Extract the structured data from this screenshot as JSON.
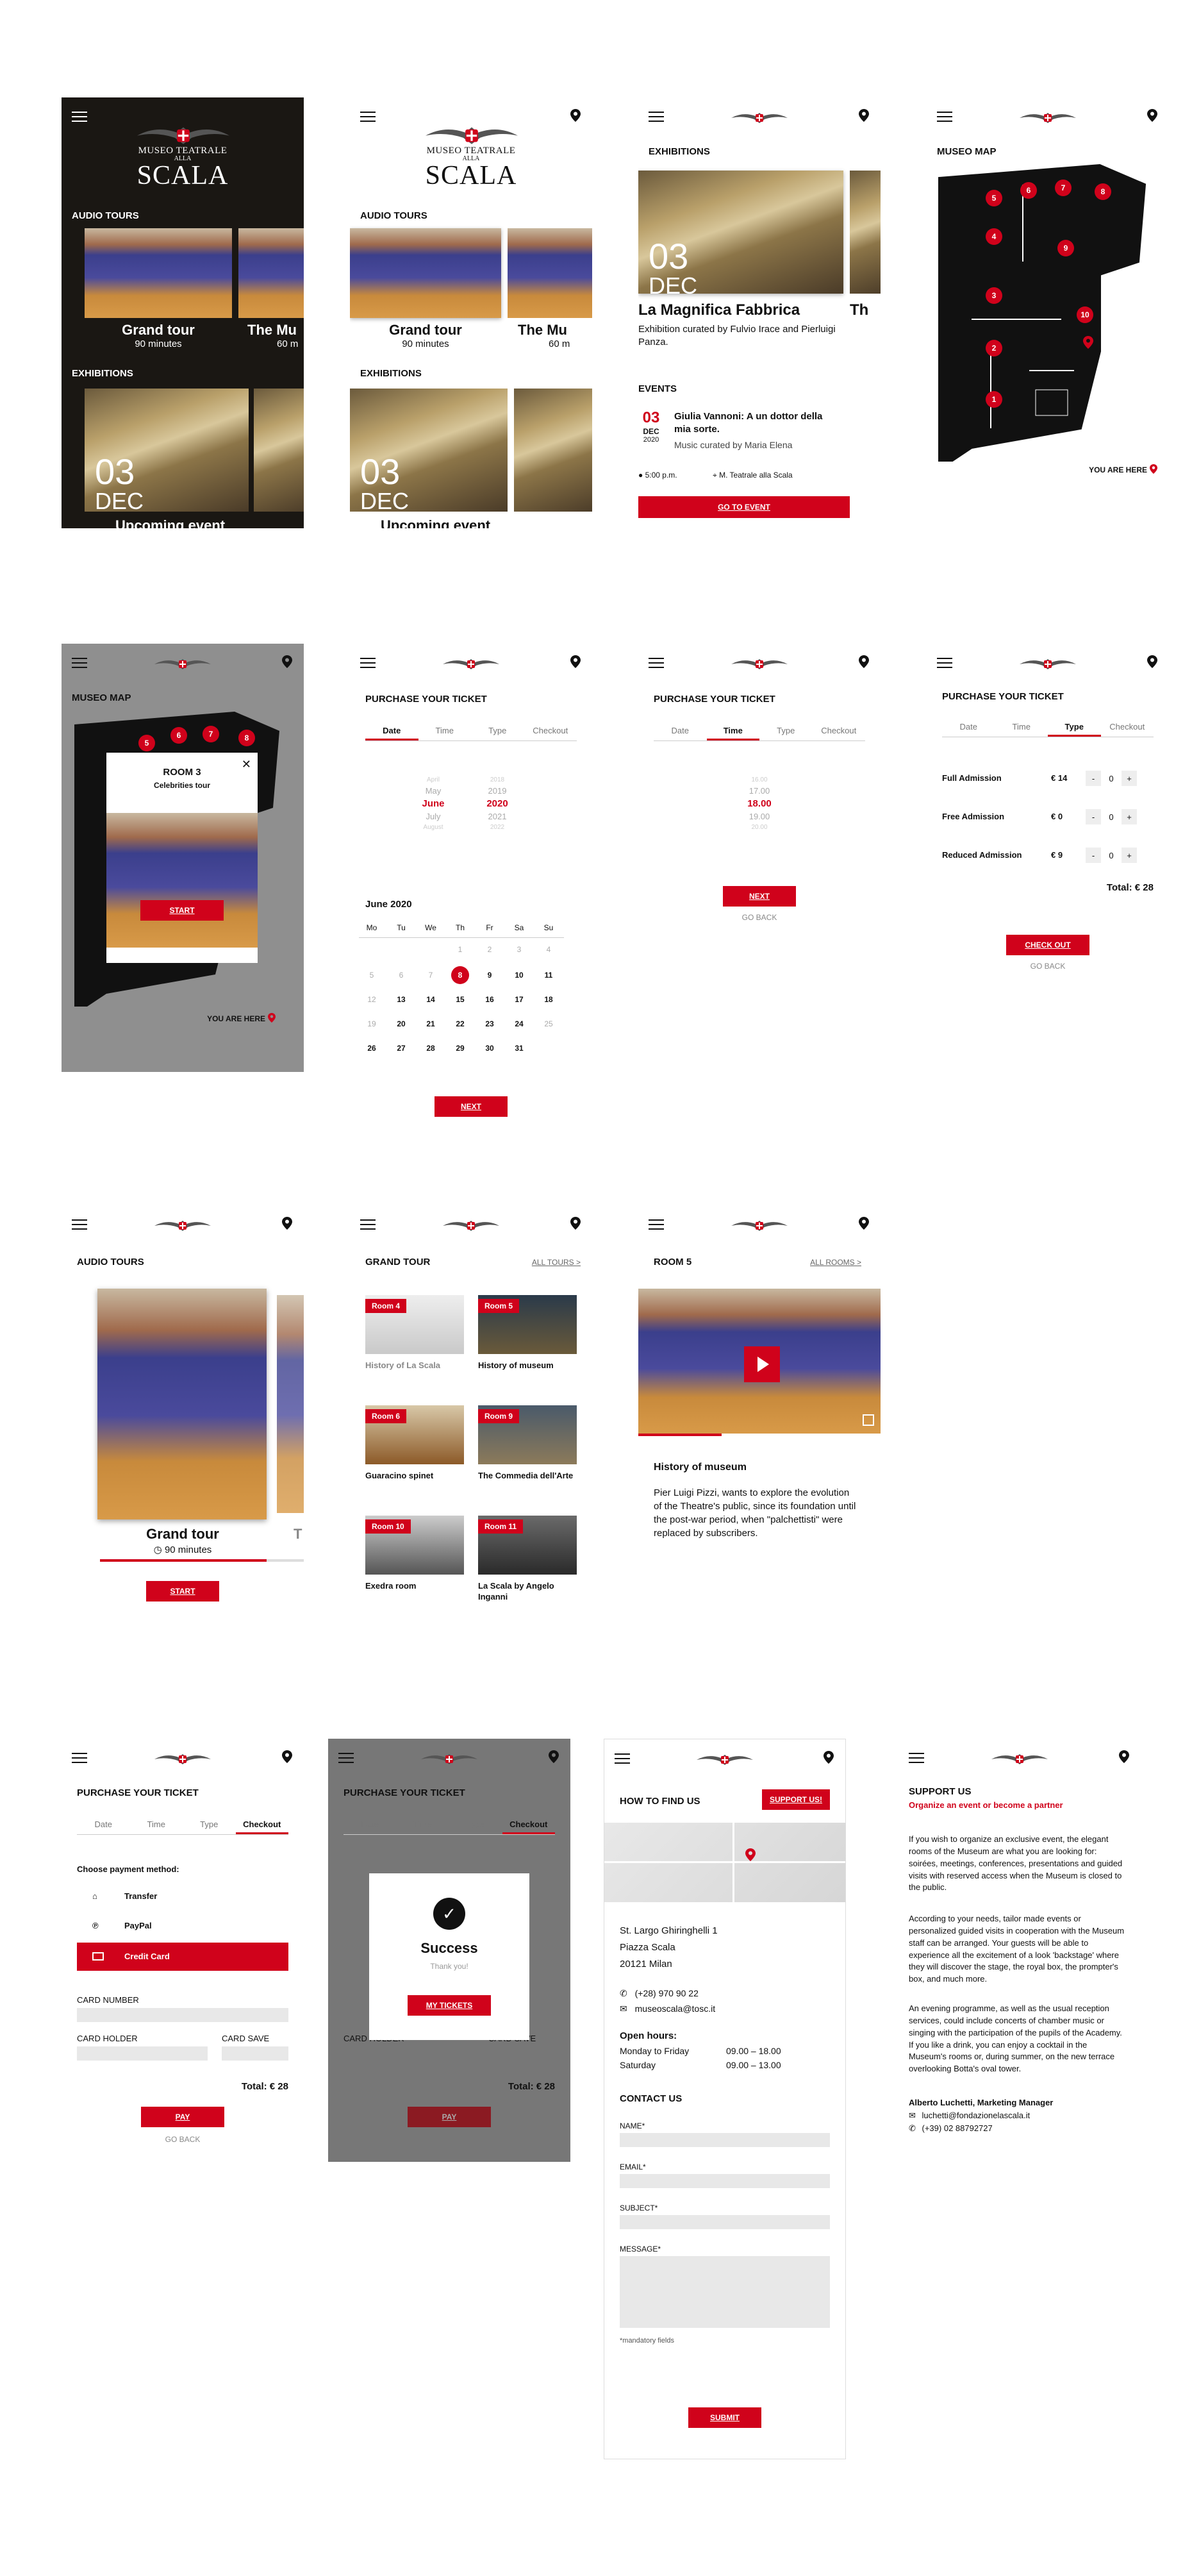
{
  "brand": {
    "logo_line1": "MUSEO TEATRALE",
    "logo_line2": "ALLA",
    "logo_line3": "SCALA"
  },
  "home": {
    "audio_tours_title": "AUDIO TOURS",
    "exhibitions_title": "EXHIBITIONS",
    "tour1_name": "Grand tour",
    "tour1_duration": "90 minutes",
    "tour2_name": "The Mu",
    "tour2_duration": "60 m",
    "exhibition_day": "03",
    "exhibition_month": "DEC",
    "upcoming_label": "Upcoming event"
  },
  "exhibitions": {
    "title": "EXHIBITIONS",
    "day": "03",
    "month": "DEC",
    "name": "La Magnifica Fabbrica",
    "name_next": "Th",
    "subtitle": "Exhibition curated by Fulvio Irace and Pierluigi Panza.",
    "events_title": "EVENTS",
    "event_day": "03",
    "event_month": "DEC",
    "event_year": "2020",
    "event_name": "Giulia Vannoni: A un dottor della mia sorte.",
    "event_curator": "Music curated by Maria Elena",
    "event_time": "5:00 p.m.",
    "event_place": "M. Teatrale alla Scala",
    "cta": "GO TO EVENT"
  },
  "map": {
    "title": "MUSEO MAP",
    "rooms": [
      "5",
      "6",
      "7",
      "8",
      "4",
      "9",
      "3",
      "10",
      "2",
      "1"
    ],
    "you_are_here": "YOU ARE HERE",
    "popup_room": "ROOM 3",
    "popup_name": "Celebrities tour",
    "popup_close": "✕",
    "popup_cta": "START"
  },
  "ticket": {
    "title": "PURCHASE YOUR TICKET",
    "tabs": [
      "Date",
      "Time",
      "Type",
      "Checkout"
    ],
    "months": [
      "April",
      "May",
      "June",
      "July",
      "August"
    ],
    "years": [
      "2018",
      "2019",
      "2020",
      "2021",
      "2022"
    ],
    "calendar_title": "June 2020",
    "weekdays": [
      "Mo",
      "Tu",
      "We",
      "Th",
      "Fr",
      "Sa",
      "Su"
    ],
    "days_row1": [
      "",
      "",
      "",
      "",
      "1",
      "2",
      "3",
      "4"
    ],
    "next": "NEXT",
    "times": [
      "16.00",
      "17.00",
      "18.00",
      "19.00",
      "20.00"
    ],
    "go_back": "GO BACK",
    "types": [
      {
        "name": "Full Admission",
        "price": "€ 14",
        "qty": "0"
      },
      {
        "name": "Free Admission",
        "price": "€ 0",
        "qty": "0"
      },
      {
        "name": "Reduced Admission",
        "price": "€ 9",
        "qty": "0"
      }
    ],
    "total": "Total: € 28",
    "checkout": "CHECK OUT",
    "payment_title": "Choose payment method:",
    "methods": [
      "Transfer",
      "PayPal",
      "Credit Card"
    ],
    "card_number": "CARD NUMBER",
    "card_holder": "CARD HOLDER",
    "card_save": "CARD SAVE",
    "pay": "PAY",
    "success_title": "Success",
    "success_sub": "Thank you!",
    "my_tickets": "MY TICKETS"
  },
  "audio": {
    "title": "AUDIO TOURS",
    "tour_name": "Grand tour",
    "tour_duration": "90 minutes",
    "next_peek": "T",
    "start": "START"
  },
  "grand_tour": {
    "title": "GRAND TOUR",
    "all_tours": "ALL TOURS >",
    "tiles": [
      {
        "room": "Room 4",
        "name": "History of La Scala"
      },
      {
        "room": "Room 5",
        "name": "History of museum"
      },
      {
        "room": "Room 6",
        "name": "Guaracino spinet"
      },
      {
        "room": "Room 9",
        "name": "The Commedia dell'Arte"
      },
      {
        "room": "Room 10",
        "name": "Exedra room"
      },
      {
        "room": "Room 11",
        "name": "La Scala by Angelo Inganni"
      }
    ]
  },
  "room5": {
    "title": "ROOM 5",
    "all_rooms": "ALL ROOMS >",
    "heading": "History of museum",
    "body": "Pier Luigi Pizzi, wants to explore the evolution of the Theatre's public, since its foundation until the post-war period, when \"palchettisti\" were replaced by subscribers."
  },
  "find_us": {
    "title": "HOW TO FIND US",
    "support": "SUPPORT US!",
    "address1": "St. Largo Ghiringhelli 1",
    "address2": "Piazza Scala",
    "address3": "20121 Milan",
    "phone": "(+28) 970 90 22",
    "email": "museoscala@tosc.it",
    "hours_title": "Open hours:",
    "hours": [
      {
        "day": "Monday to Friday",
        "time": "09.00 – 18.00"
      },
      {
        "day": "Saturday",
        "time": "09.00 – 13.00"
      }
    ],
    "contact_title": "CONTACT US",
    "f_name": "NAME*",
    "f_email": "EMAIL*",
    "f_subject": "SUBJECT*",
    "f_message": "MESSAGE*",
    "mandatory": "*mandatory fields",
    "submit": "SUBMIT"
  },
  "support": {
    "title": "SUPPORT US",
    "subtitle": "Organize an event or become a partner",
    "p1": "If you wish to organize an exclusive event, the elegant rooms of the Museum are what you are looking for: soirées, meetings, conferences, presentations and guided visits with reserved access when the Museum is closed to the public.",
    "p2": "According to your needs, tailor made events or personalized guided visits in cooperation with the Museum staff can be arranged. Your guests will be able to experience all the excitement of a look 'backstage' where they will discover the stage, the royal box, the prompter's box, and much more.",
    "p3": "An evening programme, as well as the usual reception services, could include concerts of chamber music or singing with the participation of the pupils of the Academy. If you like a drink, you can enjoy a cocktail in the Museum's rooms or, during summer, on the new terrace overlooking Botta's oval tower.",
    "contact_name": "Alberto Luchetti, Marketing Manager",
    "contact_email": "luchetti@fondazionelascala.it",
    "contact_phone": "(+39) 02 88792727"
  },
  "colors": {
    "accent": "#d0021b",
    "dark": "#1a1713",
    "overlay": "#8f8f8f"
  }
}
